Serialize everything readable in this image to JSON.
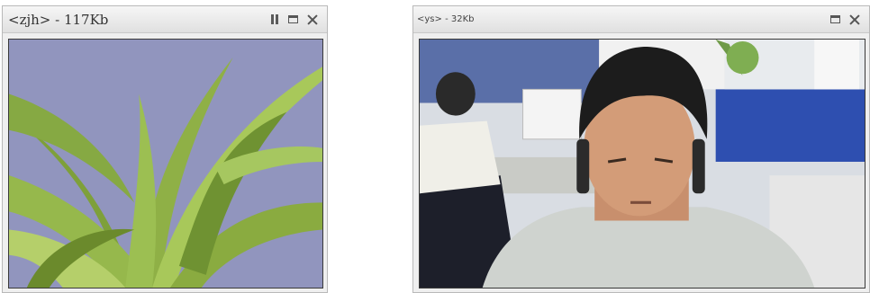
{
  "windows": [
    {
      "title": "<zjh> - 117Kb",
      "controls": [
        "pause-icon",
        "maximize-icon",
        "close-icon"
      ],
      "video": "video feed"
    },
    {
      "title": "<ys> - 32Kb",
      "controls": [
        "maximize-icon",
        "close-icon"
      ],
      "video": "video feed"
    }
  ]
}
